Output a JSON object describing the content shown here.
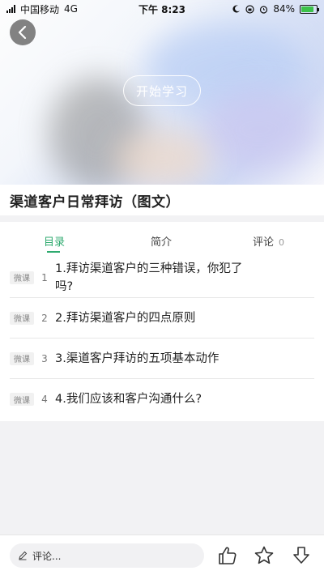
{
  "status_bar": {
    "carrier": "中国移动",
    "network": "4G",
    "time": "下午 8:23",
    "battery": "84%",
    "battery_level": 0.84
  },
  "banner": {
    "start_label": "开始学习"
  },
  "course": {
    "title": "渠道客户日常拜访（图文）"
  },
  "tabs": [
    {
      "label": "目录",
      "active": true
    },
    {
      "label": "简介",
      "active": false
    },
    {
      "label": "评论",
      "count": "0",
      "active": false
    }
  ],
  "lessons": [
    {
      "type": "微课",
      "no": "1",
      "title": "1.拜访渠道客户的三种错误，你犯了吗?"
    },
    {
      "type": "微课",
      "no": "2",
      "title": "2.拜访渠道客户的四点原则"
    },
    {
      "type": "微课",
      "no": "3",
      "title": "3.渠道客户拜访的五项基本动作"
    },
    {
      "type": "微课",
      "no": "4",
      "title": "4.我们应该和客户沟通什么?"
    }
  ],
  "bottom_bar": {
    "comment_placeholder": "评论..."
  },
  "colors": {
    "accent": "#2eaa6f",
    "battery": "#3cc24a"
  }
}
